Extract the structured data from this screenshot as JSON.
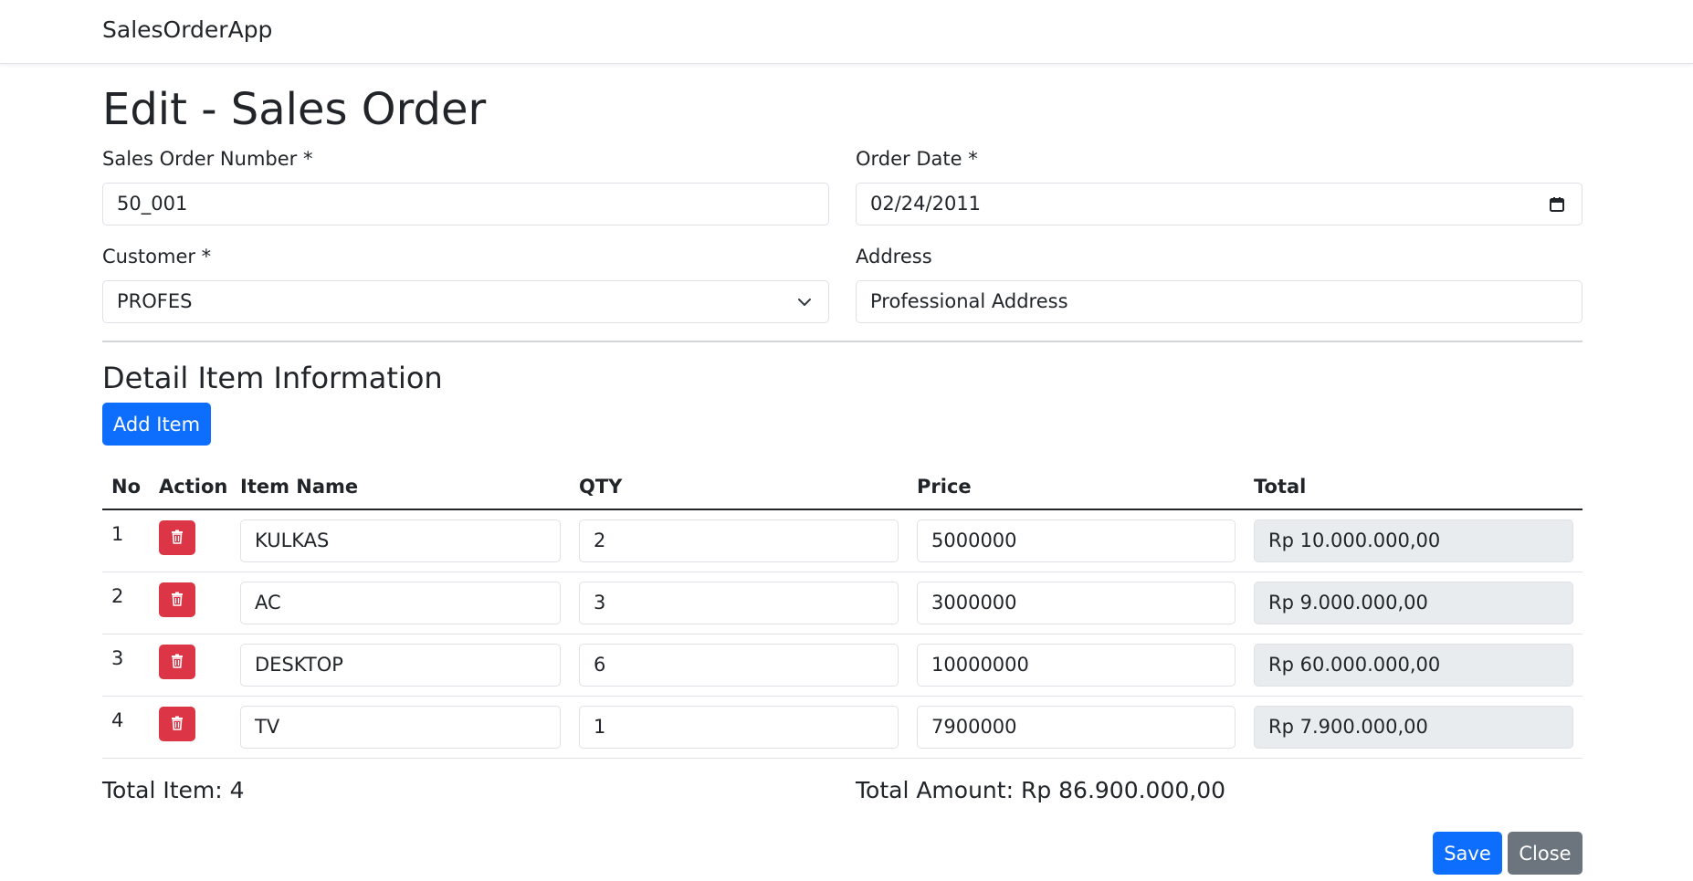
{
  "app": {
    "brand": "SalesOrderApp"
  },
  "page": {
    "title": "Edit - Sales Order"
  },
  "form": {
    "so_number": {
      "label": "Sales Order Number *",
      "value": "50_001"
    },
    "order_date": {
      "label": "Order Date *",
      "value": "02/24/2011"
    },
    "customer": {
      "label": "Customer *",
      "value": "PROFES"
    },
    "address": {
      "label": "Address",
      "value": "Professional Address"
    }
  },
  "detail": {
    "title": "Detail Item Information",
    "add_item_label": "Add Item",
    "columns": [
      "No",
      "Action",
      "Item Name",
      "QTY",
      "Price",
      "Total"
    ],
    "rows": [
      {
        "no": "1",
        "item_name": "KULKAS",
        "qty": "2",
        "price": "5000000",
        "total": "Rp 10.000.000,00"
      },
      {
        "no": "2",
        "item_name": "AC",
        "qty": "3",
        "price": "3000000",
        "total": "Rp 9.000.000,00"
      },
      {
        "no": "3",
        "item_name": "DESKTOP",
        "qty": "6",
        "price": "10000000",
        "total": "Rp 60.000.000,00"
      },
      {
        "no": "4",
        "item_name": "TV",
        "qty": "1",
        "price": "7900000",
        "total": "Rp 7.900.000,00"
      }
    ]
  },
  "summary": {
    "total_item": "Total Item: 4",
    "total_amount": "Total Amount: Rp 86.900.000,00"
  },
  "actions": {
    "save_label": "Save",
    "close_label": "Close"
  },
  "colors": {
    "primary": "#0d6efd",
    "danger": "#dc3545",
    "secondary": "#6c757d",
    "readonly_bg": "#e9ecef"
  },
  "icons": {
    "delete": "trash-icon",
    "date": "calendar-icon",
    "select": "chevron-down-icon"
  }
}
